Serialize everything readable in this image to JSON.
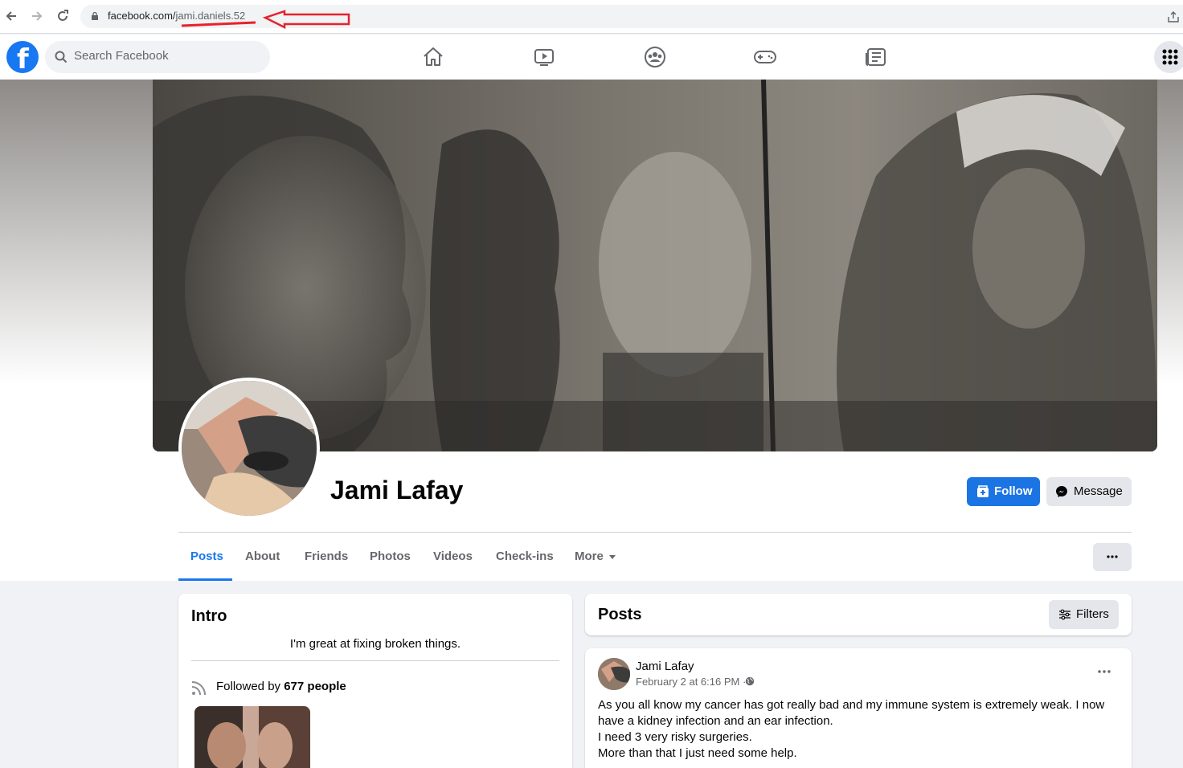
{
  "browser": {
    "url_host": "facebook.com/",
    "url_path": "jami.daniels.52"
  },
  "topnav": {
    "logo": "f",
    "search_placeholder": "Search Facebook"
  },
  "profile": {
    "name": "Jami Lafay",
    "follow_label": "Follow",
    "message_label": "Message"
  },
  "tabs": [
    {
      "label": "Posts",
      "active": true
    },
    {
      "label": "About"
    },
    {
      "label": "Friends"
    },
    {
      "label": "Photos"
    },
    {
      "label": "Videos"
    },
    {
      "label": "Check-ins"
    },
    {
      "label": "More"
    }
  ],
  "intro": {
    "title": "Intro",
    "bio": "I'm great at fixing broken things.",
    "followed_prefix": "Followed by",
    "followed_count": "677 people"
  },
  "posts_header": {
    "title": "Posts",
    "filters_label": "Filters"
  },
  "post": {
    "author": "Jami Lafay",
    "date": "February 2 at 6:16 PM ·",
    "lines": [
      "As you all know my cancer has got really bad and my immune system is extremely weak. I now have a kidney infection and an ear infection.",
      "I need 3 very risky surgeries.",
      "More than that I just need some help."
    ]
  },
  "colors": {
    "fb_blue": "#1877f2",
    "annotation_red": "#e8212c"
  }
}
